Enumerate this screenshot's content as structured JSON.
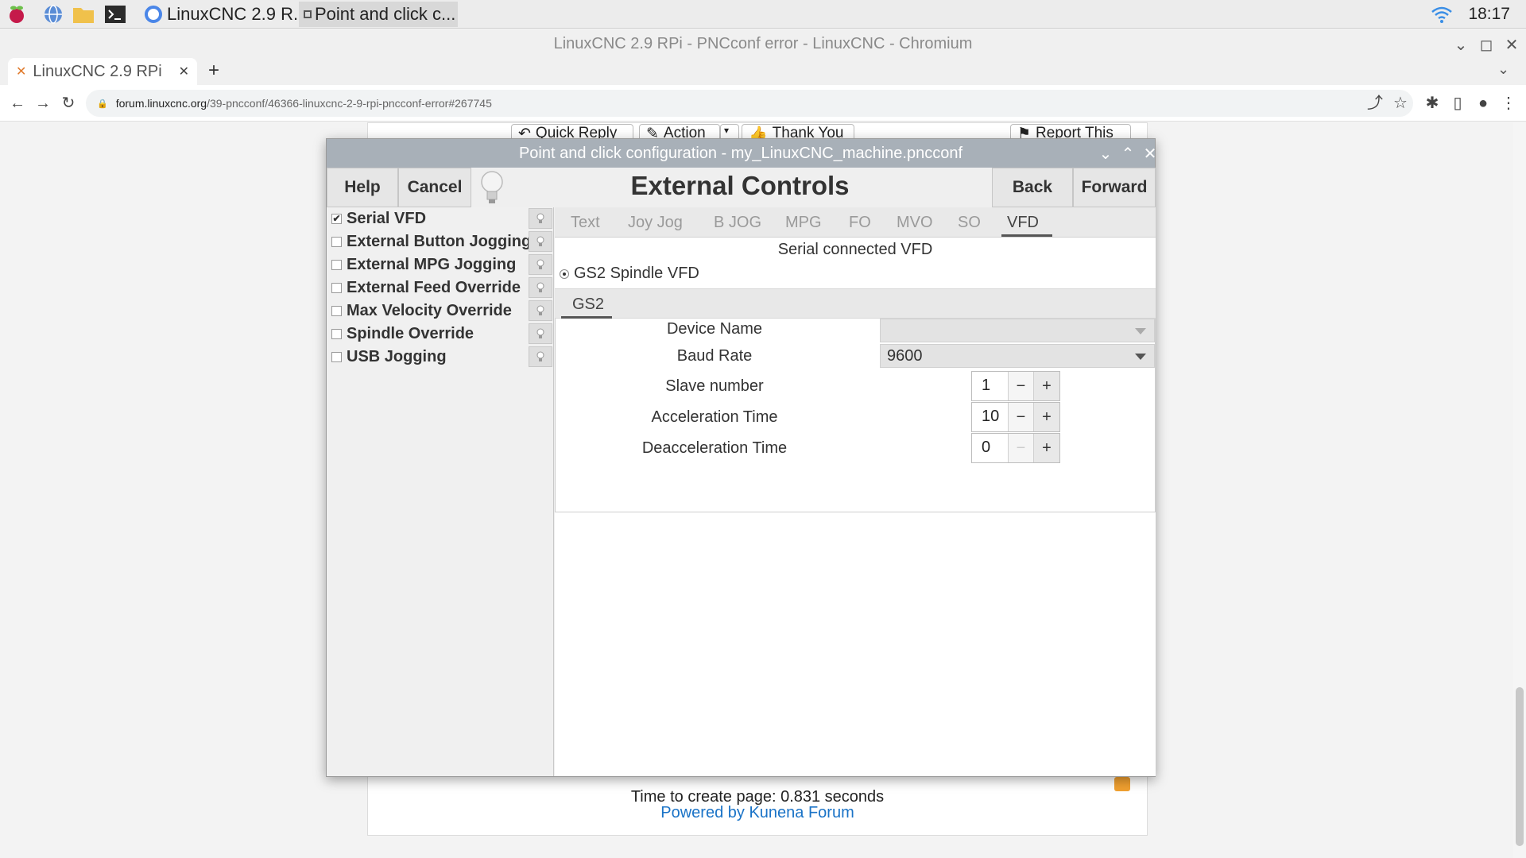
{
  "taskbar": {
    "tasks": [
      {
        "label": "LinuxCNC 2.9 R..."
      },
      {
        "label": "Point and click c..."
      }
    ],
    "clock": "18:17"
  },
  "browser": {
    "window_title": "LinuxCNC 2.9 RPi - PNCconf error - LinuxCNC - Chromium",
    "tab_title": "LinuxCNC 2.9 RPi",
    "url_domain": "forum.linuxcnc.org",
    "url_path": "/39-pncconf/46366-linuxcnc-2-9-rpi-pncconf-error#267745"
  },
  "forum": {
    "buttons": [
      "Quick Reply",
      "Action",
      "Thank You",
      "Report This"
    ],
    "footer_time": "Time to create page: 0.831 seconds",
    "footer_powered": "Powered by Kunena Forum"
  },
  "dialog": {
    "title": "Point and click configuration - my_LinuxCNC_machine.pncconf",
    "help_label": "Help",
    "cancel_label": "Cancel",
    "heading": "External Controls",
    "back_label": "Back",
    "forward_label": "Forward",
    "options": [
      {
        "label": "Serial VFD",
        "checked": true
      },
      {
        "label": "External Button Jogging",
        "checked": false
      },
      {
        "label": "External MPG Jogging",
        "checked": false
      },
      {
        "label": "External Feed Override",
        "checked": false
      },
      {
        "label": "Max Velocity Override",
        "checked": false
      },
      {
        "label": "Spindle Override",
        "checked": false
      },
      {
        "label": "USB Jogging",
        "checked": false
      }
    ],
    "tabs": [
      "Text",
      "Joy Jog",
      "B JOG",
      "MPG",
      "FO",
      "MVO",
      "SO",
      "VFD"
    ],
    "active_tab": "VFD",
    "section_title": "Serial connected VFD",
    "radio_label": "GS2 Spindle VFD",
    "subtab_label": "GS2",
    "fields": {
      "device_name": {
        "label": "Device  Name",
        "value": ""
      },
      "baud_rate": {
        "label": "Baud Rate",
        "value": "9600"
      },
      "slave_number": {
        "label": "Slave number",
        "value": "1"
      },
      "acceleration_time": {
        "label": "Acceleration Time",
        "value": "10"
      },
      "deacceleration_time": {
        "label": "Deacceleration Time",
        "value": "0"
      }
    },
    "spin_minus": "−",
    "spin_plus": "+"
  },
  "colors": {
    "dialog_titlebar": "#a8b0b8",
    "link_blue": "#1a73c7"
  }
}
